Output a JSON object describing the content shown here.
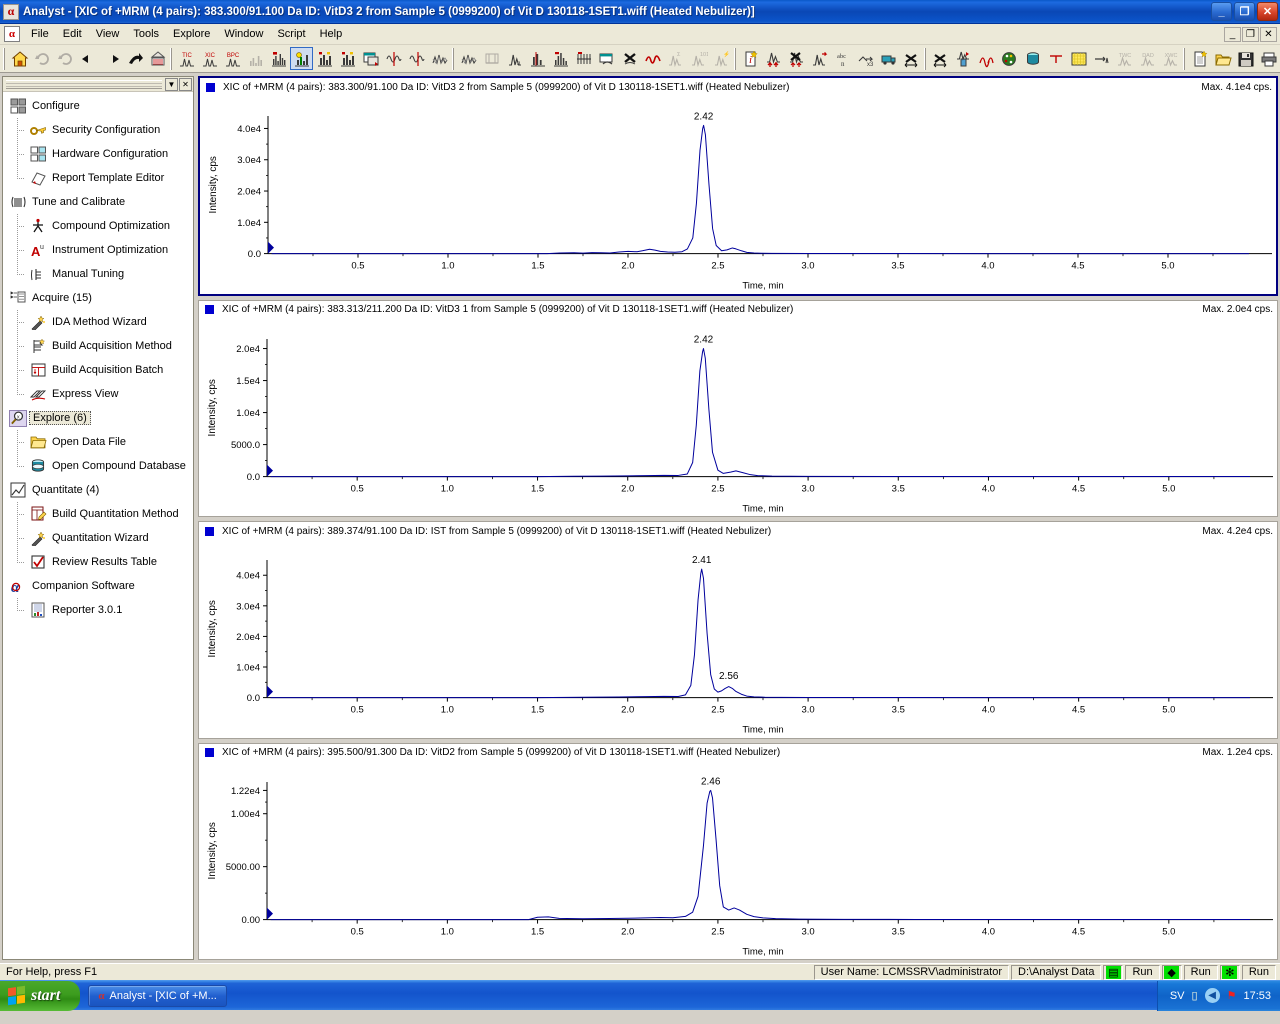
{
  "window": {
    "title": "Analyst - [XIC of +MRM (4 pairs): 383.300/91.100 Da ID: VitD3 2 from Sample 5 (0999200) of Vit D 130118-1SET1.wiff (Heated Nebulizer)]",
    "app_icon": "analyst-icon",
    "minimize_label": "_",
    "maximize_label": "❐",
    "close_label": "✕"
  },
  "menubar": {
    "icon": "analyst-document-icon",
    "items": [
      "File",
      "Edit",
      "View",
      "Tools",
      "Explore",
      "Window",
      "Script",
      "Help"
    ],
    "mdi_minimize": "_",
    "mdi_restore": "❐",
    "mdi_close": "✕"
  },
  "toolbar": {
    "groups": [
      [
        "home",
        "refresh",
        "link-broken",
        "back-arrow",
        "forward-arrow",
        "redo-arrow",
        "open-file-data"
      ],
      [
        "tic",
        "xic",
        "bpc",
        "bar-spectrum",
        "spectrum-bars",
        "show-peak-label",
        "spectrum-annot-a",
        "spectrum-annot-b",
        "overlay-window",
        "smooth-wave",
        "smooth-wave-red",
        "zigzag-wave"
      ],
      [
        "zigzag-wave2",
        "baseline-sub",
        "peak-label-a",
        "threshold-line",
        "spectrum-threshold",
        "subtract-spectra",
        "copy-to-window",
        "delete-spectra",
        "red-peak-wave",
        "sigma-peaks",
        "iso-peaks",
        "noise-peaks"
      ],
      [
        "info-new",
        "add-peaks",
        "delete-peaks",
        "next-peak",
        "abc-label",
        "x3-label",
        "truck-export",
        "arrows-expand"
      ],
      [
        "arrows-horiz",
        "peak-marker-red",
        "red-pair-wave",
        "palette",
        "database",
        "threshold-marker",
        "grid-yellow",
        "arrow-to-peak",
        "twc",
        "dad",
        "xwc"
      ],
      [
        "new-doc-star",
        "open-folder",
        "save-disk",
        "print",
        "print-preview"
      ],
      [
        "cut-scissors"
      ]
    ]
  },
  "sidebar": {
    "groups": [
      {
        "label": "Configure",
        "icon": "configure-icon",
        "count": "",
        "selected": false,
        "children": [
          {
            "label": "Security Configuration",
            "icon": "key-icon"
          },
          {
            "label": "Hardware Configuration",
            "icon": "hardware-icon"
          },
          {
            "label": "Report Template Editor",
            "icon": "report-template-icon"
          }
        ]
      },
      {
        "label": "Tune and Calibrate",
        "icon": "tune-calibrate-icon",
        "count": "",
        "selected": false,
        "children": [
          {
            "label": "Compound Optimization",
            "icon": "compound-optimization-icon"
          },
          {
            "label": "Instrument Optimization",
            "icon": "instrument-optimization-icon"
          },
          {
            "label": "Manual Tuning",
            "icon": "manual-tuning-icon"
          }
        ]
      },
      {
        "label": "Acquire",
        "icon": "acquire-icon",
        "count": "(15)",
        "selected": false,
        "children": [
          {
            "label": "IDA Method Wizard",
            "icon": "wand-icon"
          },
          {
            "label": "Build Acquisition Method",
            "icon": "build-method-icon"
          },
          {
            "label": "Build Acquisition Batch",
            "icon": "build-batch-icon"
          },
          {
            "label": "Express View",
            "icon": "express-view-icon"
          }
        ]
      },
      {
        "label": "Explore",
        "icon": "explore-magnifier-icon",
        "count": "(6)",
        "selected": true,
        "children": [
          {
            "label": "Open Data File",
            "icon": "open-folder-icon"
          },
          {
            "label": "Open Compound Database",
            "icon": "database-icon"
          }
        ]
      },
      {
        "label": "Quantitate",
        "icon": "quantitate-icon",
        "count": "(4)",
        "selected": false,
        "children": [
          {
            "label": "Build Quantitation Method",
            "icon": "build-quant-method-icon"
          },
          {
            "label": "Quantitation Wizard",
            "icon": "wand-icon"
          },
          {
            "label": "Review Results Table",
            "icon": "checkbox-results-icon"
          }
        ]
      },
      {
        "label": "Companion Software",
        "icon": "companion-software-icon",
        "count": "",
        "selected": false,
        "children": [
          {
            "label": "Reporter 3.0.1",
            "icon": "reporter-icon"
          }
        ]
      }
    ]
  },
  "statusbar": {
    "help_text": "For Help, press F1",
    "user_name": "User Name: LCMSSRV\\administrator",
    "data_path": "D:\\Analyst Data",
    "run_1": "Run",
    "run_2": "Run",
    "run_3": "Run",
    "icon_1": "queue-icon",
    "icon_2": "instrument-icon",
    "icon_3": "puzzle-icon"
  },
  "taskbar": {
    "start_label": "start",
    "task_label": "Analyst - [XIC of +M...",
    "task_icon": "analyst-icon",
    "tray_lang": "SV",
    "tray_icons": [
      "battery-icon",
      "back-arrow-icon",
      "shield-alert-icon"
    ],
    "clock": "17:53"
  },
  "chart_data": [
    {
      "type": "line",
      "focused": true,
      "title": "XIC of +MRM (4 pairs): 383.300/91.100 Da ID: VitD3 2 from Sample 5 (0999200) of Vit D 130118-1SET1.wiff (Heated Nebulizer)",
      "max_label": "Max. 4.1e4 cps.",
      "xlabel": "Time, min",
      "ylabel": "Intensity, cps",
      "xlim": [
        0.0,
        5.5
      ],
      "ylim": [
        0.0,
        44000
      ],
      "xticks": [
        0.5,
        1.0,
        1.5,
        2.0,
        2.5,
        3.0,
        3.5,
        4.0,
        4.5,
        5.0
      ],
      "xticklabels": [
        "0.5",
        "1.0",
        "1.5",
        "2.0",
        "2.5",
        "3.0",
        "3.5",
        "4.0",
        "4.5",
        "5.0"
      ],
      "yticks": [
        0,
        10000,
        20000,
        30000,
        40000
      ],
      "yticklabels": [
        "0.0",
        "1.0e4",
        "2.0e4",
        "3.0e4",
        "4.0e4"
      ],
      "annotations": [
        {
          "text": "2.42",
          "x": 2.42,
          "y": 41000
        }
      ],
      "x": [
        0.02,
        0.1,
        0.25,
        0.4,
        0.6,
        0.8,
        1.0,
        1.2,
        1.4,
        1.55,
        1.62,
        1.7,
        1.75,
        1.8,
        1.85,
        1.9,
        1.95,
        2.0,
        2.05,
        2.08,
        2.12,
        2.15,
        2.18,
        2.22,
        2.26,
        2.3,
        2.33,
        2.36,
        2.38,
        2.4,
        2.415,
        2.42,
        2.43,
        2.45,
        2.47,
        2.49,
        2.52,
        2.55,
        2.58,
        2.6,
        2.63,
        2.66,
        2.7,
        2.74,
        2.8,
        3.0,
        3.5,
        4.0,
        4.5,
        5.0,
        5.45
      ],
      "y": [
        0,
        0,
        0,
        0,
        0,
        0,
        0,
        0,
        0,
        0,
        180,
        280,
        150,
        320,
        260,
        180,
        500,
        700,
        600,
        900,
        1400,
        1100,
        700,
        500,
        420,
        600,
        1500,
        5000,
        16000,
        33000,
        40000,
        41000,
        38000,
        22000,
        8000,
        2600,
        900,
        1200,
        1800,
        1500,
        900,
        400,
        200,
        120,
        80,
        40,
        20,
        10,
        10,
        10,
        10
      ]
    },
    {
      "type": "line",
      "focused": false,
      "title": "XIC of +MRM (4 pairs): 383.313/211.200 Da ID: VitD3 1 from Sample 5 (0999200) of Vit D 130118-1SET1.wiff (Heated Nebulizer)",
      "max_label": "Max. 2.0e4 cps.",
      "xlabel": "Time, min",
      "ylabel": "Intensity, cps",
      "xlim": [
        0.0,
        5.5
      ],
      "ylim": [
        0.0,
        21500
      ],
      "xticks": [
        0.5,
        1.0,
        1.5,
        2.0,
        2.5,
        3.0,
        3.5,
        4.0,
        4.5,
        5.0
      ],
      "xticklabels": [
        "0.5",
        "1.0",
        "1.5",
        "2.0",
        "2.5",
        "3.0",
        "3.5",
        "4.0",
        "4.5",
        "5.0"
      ],
      "yticks": [
        0,
        5000,
        10000,
        15000,
        20000
      ],
      "yticklabels": [
        "0.0",
        "5000.0",
        "1.0e4",
        "1.5e4",
        "2.0e4"
      ],
      "annotations": [
        {
          "text": "2.42",
          "x": 2.42,
          "y": 20000
        }
      ],
      "x": [
        0.02,
        0.2,
        0.5,
        0.9,
        1.2,
        1.5,
        1.7,
        1.85,
        2.0,
        2.1,
        2.2,
        2.28,
        2.33,
        2.36,
        2.38,
        2.4,
        2.415,
        2.42,
        2.43,
        2.45,
        2.47,
        2.5,
        2.53,
        2.57,
        2.6,
        2.64,
        2.68,
        2.72,
        2.8,
        3.0,
        3.5,
        4.0,
        4.5,
        5.0,
        5.45
      ],
      "y": [
        0,
        0,
        0,
        0,
        0,
        0,
        60,
        80,
        120,
        150,
        200,
        180,
        400,
        2200,
        8000,
        16500,
        19500,
        20000,
        18500,
        10500,
        3800,
        1000,
        500,
        700,
        900,
        600,
        300,
        150,
        80,
        30,
        10,
        10,
        10,
        10,
        10
      ]
    },
    {
      "type": "line",
      "focused": false,
      "title": "XIC of +MRM (4 pairs): 389.374/91.100 Da ID: IST from Sample 5 (0999200) of Vit D 130118-1SET1.wiff (Heated Nebulizer)",
      "max_label": "Max. 4.2e4 cps.",
      "xlabel": "Time, min",
      "ylabel": "Intensity, cps",
      "xlim": [
        0.0,
        5.5
      ],
      "ylim": [
        0.0,
        45000
      ],
      "xticks": [
        0.5,
        1.0,
        1.5,
        2.0,
        2.5,
        3.0,
        3.5,
        4.0,
        4.5,
        5.0
      ],
      "xticklabels": [
        "0.5",
        "1.0",
        "1.5",
        "2.0",
        "2.5",
        "3.0",
        "3.5",
        "4.0",
        "4.5",
        "5.0"
      ],
      "yticks": [
        0,
        10000,
        20000,
        30000,
        40000
      ],
      "yticklabels": [
        "0.0",
        "1.0e4",
        "2.0e4",
        "3.0e4",
        "4.0e4"
      ],
      "annotations": [
        {
          "text": "2.41",
          "x": 2.41,
          "y": 42000
        },
        {
          "text": "2.56",
          "x": 2.56,
          "y": 4200
        }
      ],
      "x": [
        0.02,
        0.2,
        0.5,
        0.9,
        1.2,
        1.5,
        1.75,
        1.95,
        2.1,
        2.2,
        2.28,
        2.32,
        2.35,
        2.37,
        2.39,
        2.405,
        2.41,
        2.42,
        2.44,
        2.46,
        2.48,
        2.5,
        2.52,
        2.54,
        2.56,
        2.58,
        2.6,
        2.63,
        2.66,
        2.7,
        2.76,
        2.85,
        3.0,
        3.5,
        4.0,
        4.5,
        5.0,
        5.45
      ],
      "y": [
        0,
        0,
        0,
        0,
        0,
        0,
        100,
        200,
        300,
        400,
        350,
        900,
        4000,
        14000,
        32000,
        40500,
        42000,
        39000,
        21000,
        7500,
        2800,
        1800,
        2200,
        3000,
        3600,
        3000,
        2000,
        1100,
        500,
        250,
        120,
        60,
        30,
        15,
        10,
        10,
        10,
        10
      ]
    },
    {
      "type": "line",
      "focused": false,
      "title": "XIC of +MRM (4 pairs): 395.500/91.300 Da ID: VitD2 from Sample 5 (0999200) of Vit D 130118-1SET1.wiff (Heated Nebulizer)",
      "max_label": "Max. 1.2e4 cps.",
      "xlabel": "Time, min",
      "ylabel": "Intensity, cps",
      "xlim": [
        0.0,
        5.5
      ],
      "ylim": [
        0.0,
        13000
      ],
      "xticks": [
        0.5,
        1.0,
        1.5,
        2.0,
        2.5,
        3.0,
        3.5,
        4.0,
        4.5,
        5.0
      ],
      "xticklabels": [
        "0.5",
        "1.0",
        "1.5",
        "2.0",
        "2.5",
        "3.0",
        "3.5",
        "4.0",
        "4.5",
        "5.0"
      ],
      "yticks": [
        0,
        5000,
        10000,
        12200
      ],
      "yticklabels": [
        "0.00",
        "5000.00",
        "1.00e4",
        "1.22e4"
      ],
      "annotations": [
        {
          "text": "2.46",
          "x": 2.46,
          "y": 12200
        }
      ],
      "x": [
        0.02,
        0.2,
        0.5,
        0.9,
        1.2,
        1.45,
        1.5,
        1.56,
        1.62,
        1.75,
        1.9,
        2.0,
        2.1,
        2.18,
        2.25,
        2.32,
        2.36,
        2.39,
        2.42,
        2.44,
        2.455,
        2.46,
        2.47,
        2.49,
        2.51,
        2.53,
        2.56,
        2.59,
        2.62,
        2.66,
        2.7,
        2.75,
        2.82,
        2.95,
        3.2,
        3.6,
        4.0,
        4.5,
        5.0,
        5.45
      ],
      "y": [
        0,
        0,
        0,
        0,
        0,
        0,
        220,
        260,
        120,
        80,
        100,
        130,
        160,
        200,
        180,
        300,
        700,
        2200,
        7000,
        11000,
        12100,
        12200,
        11500,
        7500,
        3200,
        1200,
        900,
        1100,
        900,
        500,
        280,
        160,
        90,
        50,
        25,
        15,
        10,
        10,
        10,
        10
      ]
    }
  ]
}
